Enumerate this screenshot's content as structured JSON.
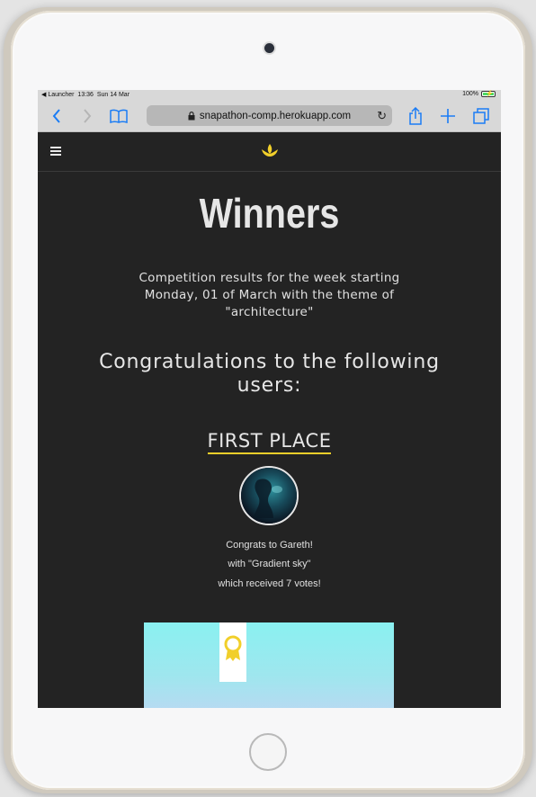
{
  "status_bar": {
    "back_app": "◀ Launcher",
    "time": "13:36",
    "date": "Sun 14 Mar",
    "battery": "100%",
    "battery_level": 1.0
  },
  "browser": {
    "url": "snapathon-comp.herokuapp.com",
    "icons": [
      "chevron-left-icon",
      "chevron-right-icon",
      "book-icon",
      "lock-icon",
      "reload-icon",
      "share-icon",
      "plus-icon",
      "tabs-icon"
    ]
  },
  "site": {
    "menu_icon": "hamburger-icon",
    "logo_icon": "lotus-logo-icon",
    "accent_color": "#f1cf2a"
  },
  "page": {
    "title": "Winners",
    "intro": "Competition results for the week starting Monday, 01 of March with the theme of \"architecture\"",
    "congrats_heading": "Congratulations to the following users:",
    "first_place": {
      "heading": "FIRST PLACE",
      "line1": "Congrats to Gareth!",
      "line2": "with \"Gradient sky\"",
      "line3": "which received 7 votes!"
    },
    "award_icon": "award-ribbon-icon"
  }
}
